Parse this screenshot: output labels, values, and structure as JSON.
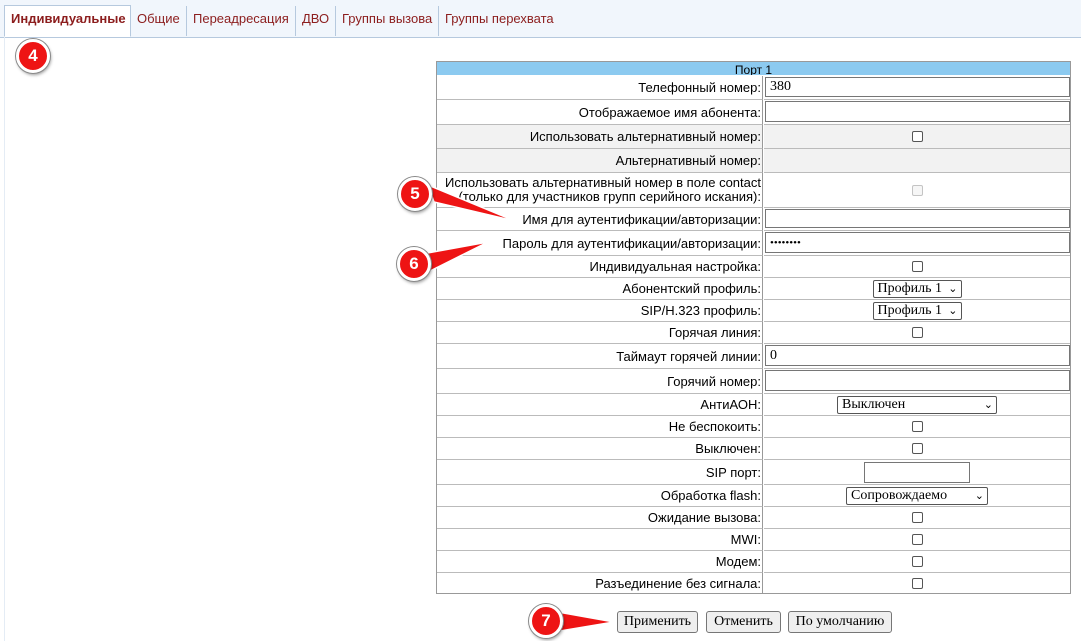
{
  "tabs": [
    {
      "label": "Индивидуальные",
      "active": true
    },
    {
      "label": "Общие"
    },
    {
      "label": "Переадресация"
    },
    {
      "label": "ДВО"
    },
    {
      "label": "Группы вызова"
    },
    {
      "label": "Группы перехвата"
    }
  ],
  "form": {
    "header": "Порт 1",
    "phone_label": "Телефонный номер:",
    "phone_value": "380",
    "display_name_label": "Отображаемое имя абонента:",
    "display_name_value": "",
    "use_alt_label": "Использовать альтернативный номер:",
    "alt_number_label": "Альтернативный номер:",
    "alt_contact_label_1": "Использовать альтернативный номер в поле contact",
    "alt_contact_label_2": "(только для участников групп серийного искания):",
    "auth_name_label": "Имя для аутентификации/авторизации:",
    "auth_name_value": "",
    "auth_pass_label": "Пароль для аутентификации/авторизации:",
    "auth_pass_value": "••••••••",
    "individual_label": "Индивидуальная настройка:",
    "profile_label": "Абонентский профиль:",
    "profile_value": "Профиль 1",
    "sip_profile_label": "SIP/H.323 профиль:",
    "sip_profile_value": "Профиль 1",
    "hotline_label": "Горячая линия:",
    "hotline_timeout_label": "Таймаут горячей линии:",
    "hotline_timeout_value": "0",
    "hot_number_label": "Горячий номер:",
    "hot_number_value": "",
    "anti_aon_label": "АнтиАОН:",
    "anti_aon_value": "Выключен",
    "dnd_label": "Не беспокоить:",
    "disabled_label": "Выключен:",
    "sip_port_label": "SIP порт:",
    "sip_port_value": "",
    "flash_label": "Обработка flash:",
    "flash_value": "Сопровождаемо",
    "call_waiting_label": "Ожидание вызова:",
    "mwi_label": "MWI:",
    "modem_label": "Модем:",
    "no_signal_label": "Разъединение без сигнала:"
  },
  "buttons": {
    "apply": "Применить",
    "cancel": "Отменить",
    "default": "По умолчанию"
  },
  "markers": [
    "4",
    "5",
    "6",
    "7"
  ],
  "colors": {
    "marker": "#ee1414",
    "tab_text": "#8c1d1d",
    "header": "#8ccaf0"
  }
}
